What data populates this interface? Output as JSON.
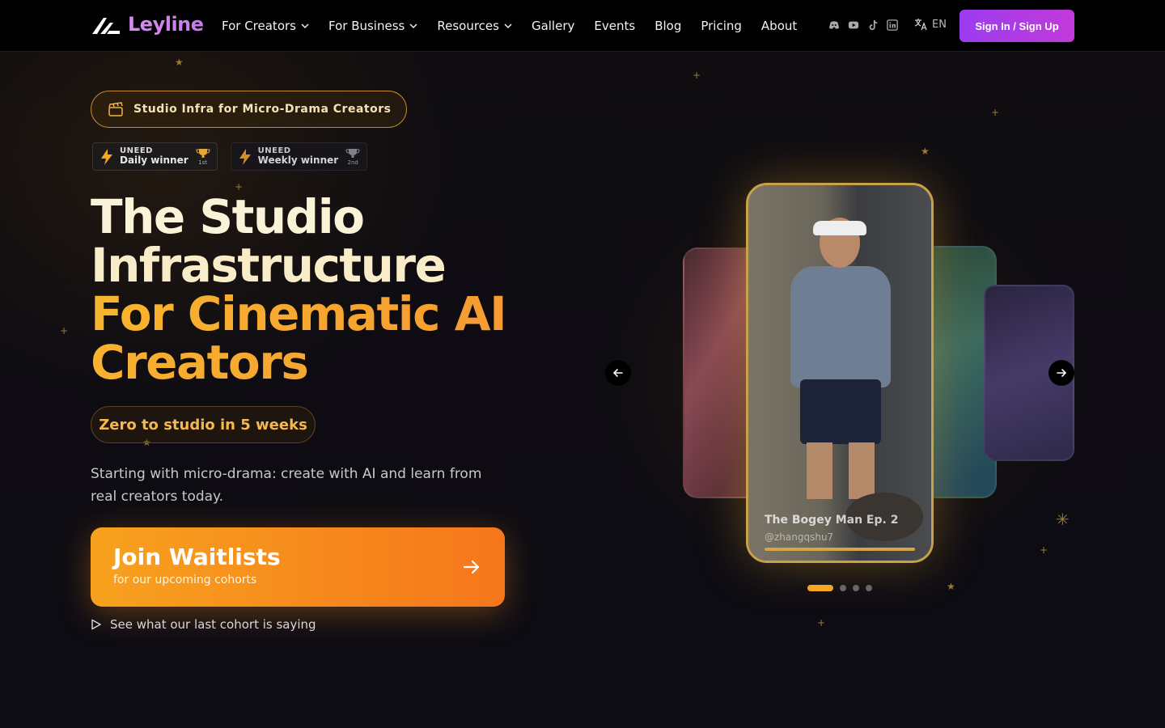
{
  "nav": {
    "brand": "Leyline",
    "menu": [
      {
        "label": "For Creators",
        "dropdown": true
      },
      {
        "label": "For Business",
        "dropdown": true
      },
      {
        "label": "Resources",
        "dropdown": true
      },
      {
        "label": "Gallery",
        "dropdown": false
      },
      {
        "label": "Events",
        "dropdown": false
      },
      {
        "label": "Blog",
        "dropdown": false
      },
      {
        "label": "Pricing",
        "dropdown": false
      },
      {
        "label": "About",
        "dropdown": false
      }
    ],
    "socials": [
      "discord-icon",
      "youtube-icon",
      "tiktok-icon",
      "linkedin-icon"
    ],
    "language": "EN",
    "signin_label": "Sign In / Sign Up"
  },
  "hero": {
    "badge": "Studio Infra for Micro-Drama Creators",
    "awards": [
      {
        "brand": "UNEED",
        "label": "Daily winner",
        "rank": "1st"
      },
      {
        "brand": "UNEED",
        "label": "Weekly winner",
        "rank": "2nd"
      }
    ],
    "headline": {
      "line1": "The Studio",
      "line2": "Infrastructure",
      "line3": "For Cinematic AI",
      "line4": "Creators"
    },
    "pill": "Zero to studio in 5 weeks",
    "subtitle": "Starting with micro-drama: create with AI and learn from real creators today.",
    "cta": {
      "title": "Join Waitlists",
      "subtitle": "for our upcoming cohorts"
    },
    "watch_link": "See what our last cohort is saying"
  },
  "carousel": {
    "active": {
      "title": "The Bogey Man Ep. 2",
      "handle": "@zhangqshu7"
    },
    "slide_count": 4,
    "active_index": 0
  },
  "colors": {
    "accent": "#f5a623",
    "brand_purple": "#c23ad9",
    "background": "#0d0c12"
  }
}
